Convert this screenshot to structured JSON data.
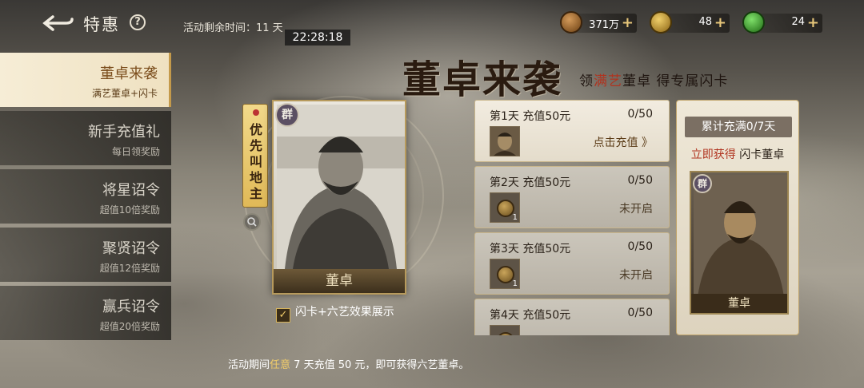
{
  "header": {
    "title": "特惠",
    "help_label": "?",
    "remaining_label": "活动剩余时间：11 天",
    "timer": "22:28:18"
  },
  "currencies": [
    {
      "name": "copper",
      "value": "371万",
      "color": "#a8743a"
    },
    {
      "name": "gold",
      "value": "48",
      "color": "#d6a73a"
    },
    {
      "name": "jade",
      "value": "24",
      "color": "#3fae3a"
    }
  ],
  "sidebar": {
    "items": [
      {
        "title": "董卓来袭",
        "subtitle": "满艺董卓+闪卡",
        "active": true
      },
      {
        "title": "新手充值礼",
        "subtitle": "每日领奖励"
      },
      {
        "title": "将星诏令",
        "subtitle": "超值10倍奖励"
      },
      {
        "title": "聚贤诏令",
        "subtitle": "超值12倍奖励"
      },
      {
        "title": "赢兵诏令",
        "subtitle": "超值20倍奖励"
      }
    ]
  },
  "banner": {
    "title": "董卓来袭",
    "slogan_pre": "领",
    "slogan_hl": "满艺",
    "slogan_post": "董卓  得专属闪卡"
  },
  "card": {
    "faction": "群",
    "name": "董卓",
    "tag": "优先叫地主"
  },
  "showcase_label": "闪卡+六艺效果展示",
  "days": [
    {
      "title": "第1天 充值50元",
      "progress": "0/50",
      "item_count": "",
      "action": "点击充值 》",
      "state": "active"
    },
    {
      "title": "第2天 充值50元",
      "progress": "0/50",
      "item_count": "1",
      "action": "未开启",
      "state": "locked"
    },
    {
      "title": "第3天 充值50元",
      "progress": "0/50",
      "item_count": "1",
      "action": "未开启",
      "state": "locked"
    },
    {
      "title": "第4天 充值50元",
      "progress": "0/50",
      "item_count": "",
      "action": "",
      "state": "locked"
    }
  ],
  "reward": {
    "header": "累计充满0/7天",
    "line_red": "立即获得",
    "line_rest": " 闪卡董卓",
    "faction": "群",
    "card_name": "董卓"
  },
  "footer": {
    "pre": "活动期间",
    "hl": "任意",
    "post": " 7 天充值 50 元，即可获得六艺董卓。"
  }
}
